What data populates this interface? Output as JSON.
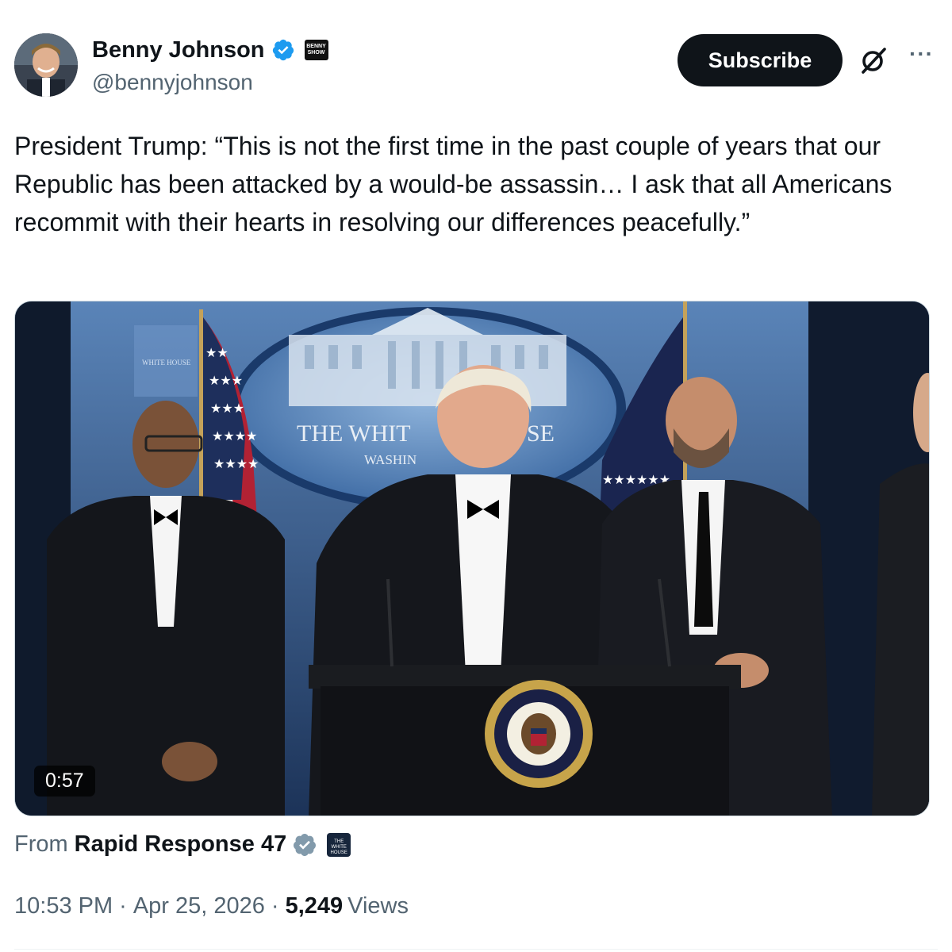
{
  "post": {
    "author": {
      "display_name": "Benny Johnson",
      "handle": "@bennyjohnson",
      "verified": true,
      "affiliate_badge": "BENNY SHOW"
    },
    "actions": {
      "subscribe_label": "Subscribe",
      "grok_icon": "grok-icon",
      "more_icon": "more-icon"
    },
    "text": "President Trump: “This is not the first time in the past couple of years that our Republic has been attacked by a would-be assassin… I ask that all Americans recommit with their hearts in resolving our differences peacefully.”",
    "media": {
      "type": "video",
      "duration": "0:57",
      "backdrop_text_1": "THE WHIT",
      "backdrop_text_2": "SE",
      "backdrop_text_3": "WASHIN"
    },
    "source": {
      "prefix": "From",
      "name": "Rapid Response 47",
      "badge": "THE WHITE HOUSE"
    },
    "meta": {
      "time": "10:53 PM",
      "separator": "·",
      "date": "Apr 25, 2026",
      "views_count": "5,249",
      "views_label": "Views"
    },
    "colors": {
      "text_primary": "#0f1419",
      "text_secondary": "#536471",
      "verified_blue": "#1d9bf0",
      "subscribe_bg": "#0f1419"
    }
  }
}
